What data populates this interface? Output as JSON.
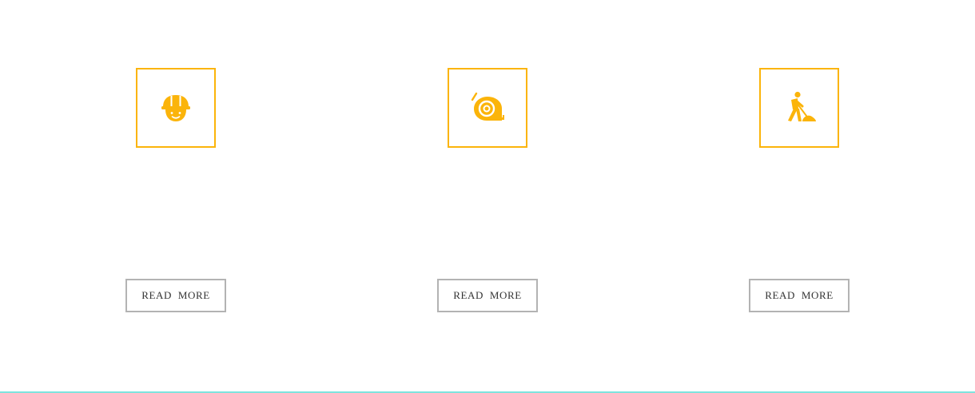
{
  "colors": {
    "accent": "#fbb40a",
    "button_border": "#b3b3b3",
    "button_text": "#333333",
    "bottom_rule": "#7fe3de"
  },
  "services": [
    {
      "icon": "construction-worker-icon",
      "button_label": "READ  MORE"
    },
    {
      "icon": "tape-measure-icon",
      "button_label": "READ  MORE"
    },
    {
      "icon": "worker-shoveling-icon",
      "button_label": "READ  MORE"
    }
  ]
}
